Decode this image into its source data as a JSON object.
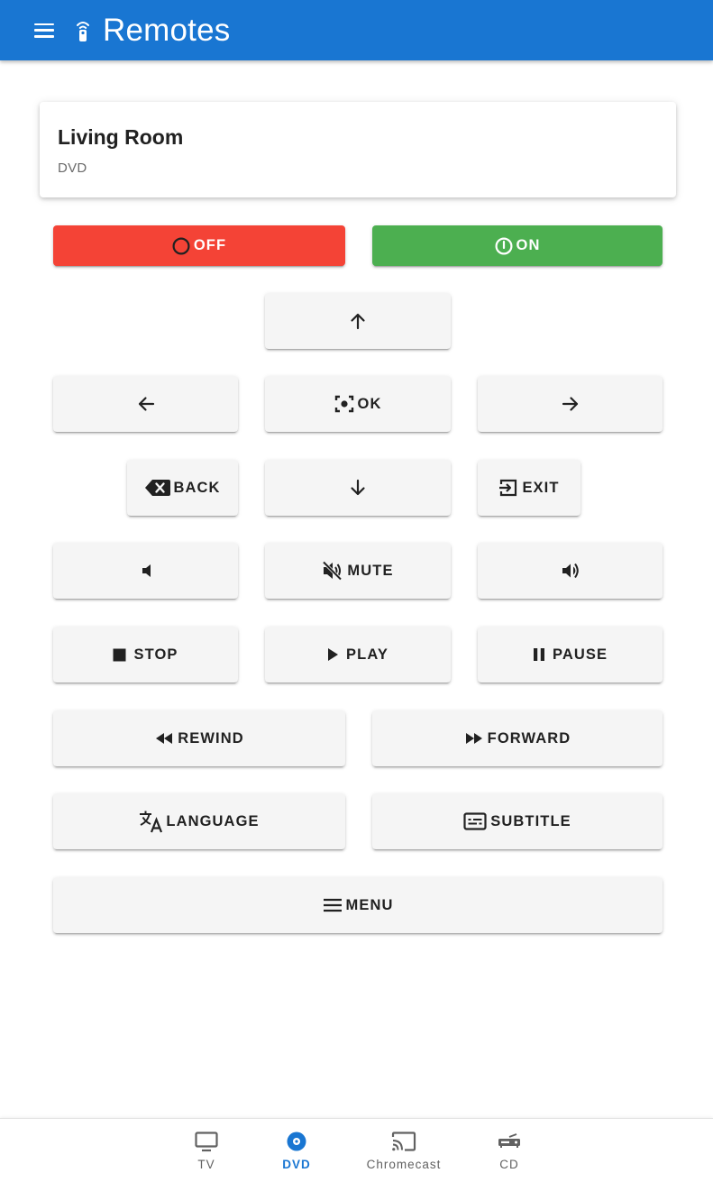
{
  "app": {
    "title": "Remotes"
  },
  "device": {
    "name": "Living Room",
    "type": "DVD"
  },
  "buttons": {
    "off": "OFF",
    "on": "ON",
    "ok": "OK",
    "back": "BACK",
    "exit": "EXIT",
    "mute": "MUTE",
    "stop": "STOP",
    "play": "PLAY",
    "pause": "PAUSE",
    "rewind": "REWIND",
    "forward": "FORWARD",
    "language": "LANGUAGE",
    "subtitle": "SUBTITLE",
    "menu": "MENU"
  },
  "nav": {
    "items": [
      {
        "label": "TV",
        "icon": "tv-icon"
      },
      {
        "label": "DVD",
        "icon": "disc-icon"
      },
      {
        "label": "Chromecast",
        "icon": "cast-icon"
      },
      {
        "label": "CD",
        "icon": "cd-player-icon"
      }
    ],
    "active": "DVD"
  },
  "colors": {
    "primary": "#1976d2",
    "off": "#f44336",
    "on": "#4caf50",
    "button": "#f5f5f5"
  }
}
